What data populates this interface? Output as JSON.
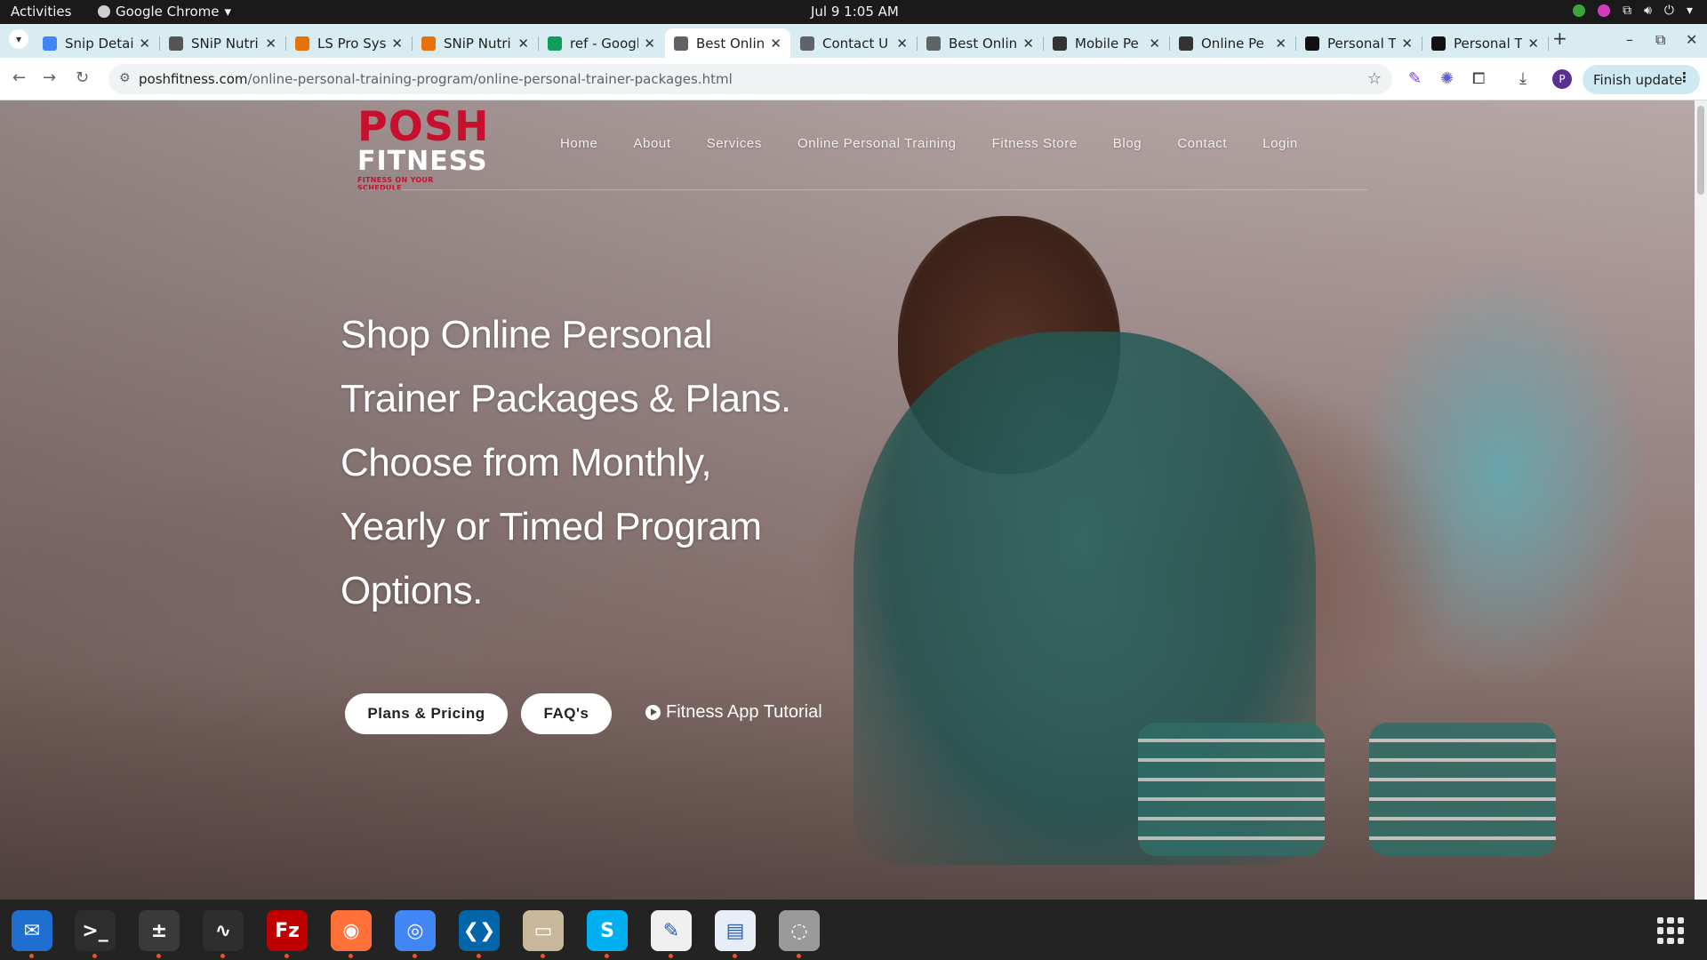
{
  "os": {
    "activities": "Activities",
    "app_name": "Google Chrome",
    "clock": "Jul 9  1:05 AM"
  },
  "tabs": [
    {
      "title": "Snip Detai",
      "icon": "docs-icon",
      "color": "#4285f4"
    },
    {
      "title": "SNiP Nutri",
      "icon": "snip-icon",
      "color": "#555555"
    },
    {
      "title": "LS Pro Sys",
      "icon": "ls-icon",
      "color": "#e8710a"
    },
    {
      "title": "SNiP Nutri",
      "icon": "snip-icon",
      "color": "#e8710a"
    },
    {
      "title": "ref - Googl",
      "icon": "sheets-icon",
      "color": "#0f9d58"
    },
    {
      "title": "Best Onlin",
      "icon": "globe-icon",
      "color": "#5f6368",
      "active": true
    },
    {
      "title": "Contact U",
      "icon": "globe-icon",
      "color": "#5f6368"
    },
    {
      "title": "Best Onlin",
      "icon": "globe-icon",
      "color": "#5f6368"
    },
    {
      "title": "Mobile Pe",
      "icon": "site-icon",
      "color": "#333333"
    },
    {
      "title": "Online Pe",
      "icon": "site-icon",
      "color": "#333333"
    },
    {
      "title": "Personal T",
      "icon": "fs-icon",
      "color": "#111111"
    },
    {
      "title": "Personal T",
      "icon": "fs-icon",
      "color": "#111111"
    }
  ],
  "toolbar": {
    "url_host": "poshfitness.com",
    "url_path": "/online-personal-training-program/online-personal-trainer-packages.html",
    "finish_update": "Finish update",
    "profile_initial": "P"
  },
  "site": {
    "logo_line1": "POSH",
    "logo_line2": "FITNESS",
    "logo_tagline": "FITNESS ON YOUR SCHEDULE",
    "nav": [
      "Home",
      "About",
      "Services",
      "Online Personal Training",
      "Fitness Store",
      "Blog",
      "Contact",
      "Login"
    ],
    "hero_lines": [
      "Shop Online Personal",
      "Trainer Packages & Plans.",
      "Choose from Monthly,",
      "Yearly or Timed Program",
      "Options."
    ],
    "btn_plans": "Plans & Pricing",
    "btn_faq": "FAQ's",
    "tutorial": "Fitness App Tutorial"
  },
  "dock": [
    {
      "name": "thunderbird-icon",
      "color": "#1f6fd1"
    },
    {
      "name": "terminal-icon",
      "color": "#2d2d2d"
    },
    {
      "name": "calculator-icon",
      "color": "#3a3a3a"
    },
    {
      "name": "system-monitor-icon",
      "color": "#2e2e2e"
    },
    {
      "name": "filezilla-icon",
      "color": "#bf0000"
    },
    {
      "name": "firefox-icon",
      "color": "#ff7139"
    },
    {
      "name": "chrome-icon",
      "color": "#4285f4"
    },
    {
      "name": "vscode-icon",
      "color": "#0065a9"
    },
    {
      "name": "files-icon",
      "color": "#c9b79c"
    },
    {
      "name": "skype-icon",
      "color": "#00aff0"
    },
    {
      "name": "text-editor-icon",
      "color": "#f0f0f0"
    },
    {
      "name": "document-viewer-icon",
      "color": "#e8eef8"
    },
    {
      "name": "disk-icon",
      "color": "#9a9a9a"
    }
  ]
}
